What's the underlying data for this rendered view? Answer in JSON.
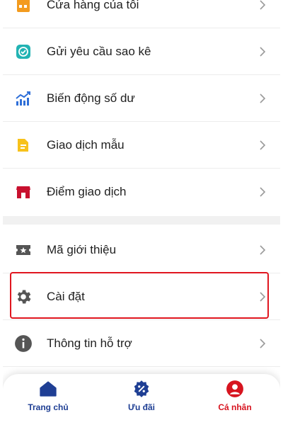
{
  "menu": {
    "items": [
      {
        "label": "Cửa hàng của tôi",
        "icon": "store-icon"
      },
      {
        "label": "Gửi yêu cầu sao kê",
        "icon": "statement-check-icon"
      },
      {
        "label": "Biến động số dư",
        "icon": "trend-chart-icon"
      },
      {
        "label": "Giao dịch mẫu",
        "icon": "document-template-icon"
      },
      {
        "label": "Điểm giao dịch",
        "icon": "shop-location-icon"
      },
      {
        "label": "Mã giới thiệu",
        "icon": "ticket-star-icon"
      },
      {
        "label": "Cài đặt",
        "icon": "gear-icon",
        "highlighted": true
      },
      {
        "label": "Thông tin hỗ trợ",
        "icon": "info-icon"
      }
    ]
  },
  "bottom_nav": {
    "items": [
      {
        "label": "Trang chủ",
        "icon": "home-icon",
        "active": false
      },
      {
        "label": "Ưu đãi",
        "icon": "discount-badge-icon",
        "active": false
      },
      {
        "label": "Cá nhân",
        "icon": "user-icon",
        "active": true
      }
    ]
  },
  "colors": {
    "nav_blue": "#1f3f94",
    "nav_active": "#d7141f",
    "highlight_border": "#e0161f",
    "text": "#1f1f1f"
  }
}
